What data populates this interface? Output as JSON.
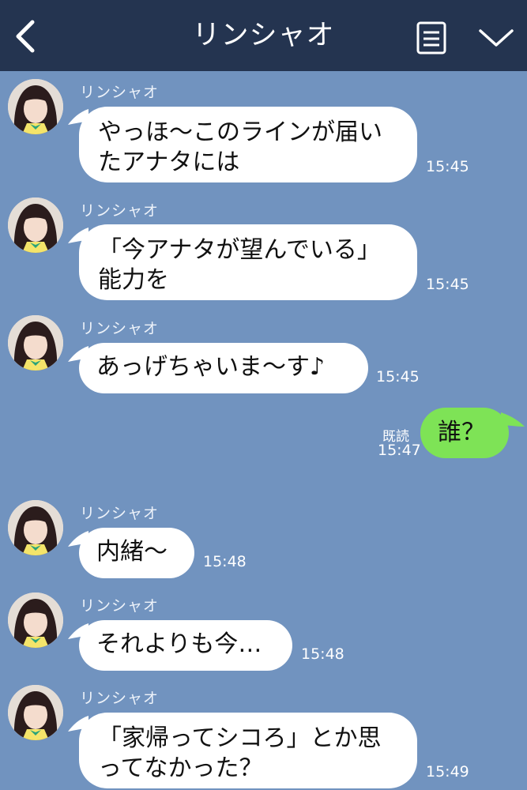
{
  "header": {
    "title": "リンシャオ",
    "back_icon": "chevron-left-icon",
    "menu_icon": "notes-icon",
    "collapse_icon": "chevron-down-icon"
  },
  "colors": {
    "background": "#7193bf",
    "header": "#243450",
    "incoming_bubble": "#ffffff",
    "outgoing_bubble": "#7ee356"
  },
  "messages": [
    {
      "sender": "リンシャオ",
      "text": "やっほ〜このラインが届い\nたアナタには",
      "time": "15:45"
    },
    {
      "sender": "リンシャオ",
      "text": "「今アナタが望んでいる」\n能力を",
      "time": "15:45"
    },
    {
      "sender": "リンシャオ",
      "text": "あっげちゃいま〜す♪",
      "time": "15:45"
    },
    {
      "outgoing": true,
      "text": "誰？",
      "read": "既読",
      "time": "15:47"
    },
    {
      "sender": "リンシャオ",
      "text": "内緒〜",
      "time": "15:48"
    },
    {
      "sender": "リンシャオ",
      "text": "それよりも今…",
      "time": "15:48"
    },
    {
      "sender": "リンシャオ",
      "text": "「家帰ってシコろ」とか思\nってなかった？",
      "time": "15:49"
    }
  ]
}
